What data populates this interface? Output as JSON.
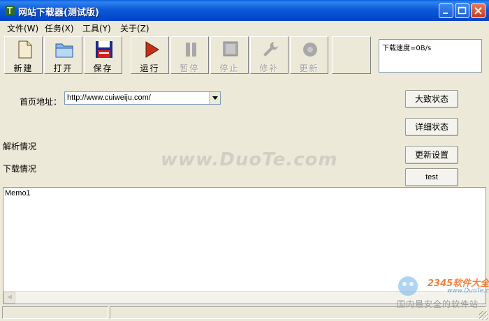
{
  "window": {
    "title": "网站下载器(测试版)"
  },
  "menu": [
    {
      "label": "文件(W)"
    },
    {
      "label": "任务(X)"
    },
    {
      "label": "工具(Y)"
    },
    {
      "label": "关于(Z)"
    }
  ],
  "toolbar": {
    "new_label": "新建",
    "open_label": "打开",
    "save_label": "保存",
    "run_label": "运行",
    "pause_label": "暂停",
    "stop_label": "停止",
    "repair_label": "修补",
    "update_label": "更新"
  },
  "speed": {
    "text": "下载速度=0B/s"
  },
  "form": {
    "url_label": "首页地址：",
    "url_value": "http://www.cuiweiju.com/"
  },
  "buttons": {
    "summary_status": "大致状态",
    "detail_status": "详细状态",
    "update_settings": "更新设置",
    "test": "test"
  },
  "labels": {
    "parse_status": "解析情况",
    "download_status": "下载情况"
  },
  "memo": {
    "text": "Memo1"
  },
  "watermark": {
    "main": "www.DuoTe.com",
    "brand": "2345软件大全",
    "url": "www.DuoTe.com",
    "tagline": "国内最安全的软件站"
  },
  "colors": {
    "titlebar": "#0054e3",
    "window_bg": "#ece9d8",
    "run_icon": "#c0301a",
    "save_icon": "#1a2a8a"
  }
}
